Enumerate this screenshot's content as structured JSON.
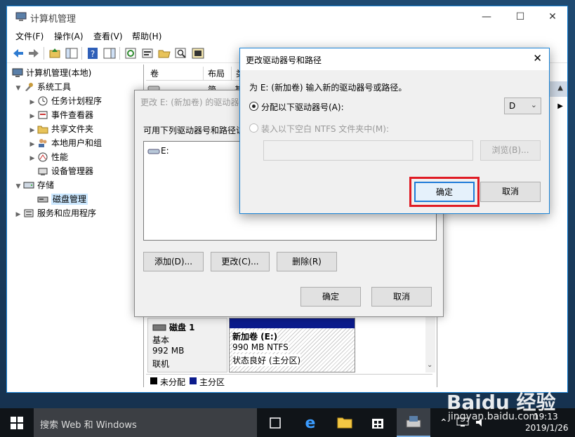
{
  "main_window": {
    "title": "计算机管理",
    "menus": [
      "文件(F)",
      "操作(A)",
      "查看(V)",
      "帮助(H)"
    ]
  },
  "tree": {
    "root": "计算机管理(本地)",
    "system_tools": "系统工具",
    "task_scheduler": "任务计划程序",
    "event_viewer": "事件查看器",
    "shared_folders": "共享文件夹",
    "local_users": "本地用户和组",
    "performance": "性能",
    "device_manager": "设备管理器",
    "storage": "存储",
    "disk_management": "磁盘管理",
    "services_apps": "服务和应用程序"
  },
  "volume_list": {
    "col_volume": "卷",
    "col_layout": "布局",
    "col_type_partial": "类",
    "row_layout": "简单",
    "row_type_partial": "基"
  },
  "disk": {
    "name": "磁盘 1",
    "type": "基本",
    "size": "992 MB",
    "status": "联机",
    "volume_name": "新加卷  (E:)",
    "volume_size": "990 MB NTFS",
    "volume_status": "状态良好 (主分区)"
  },
  "legend": {
    "unallocated": "未分配",
    "primary": "主分区"
  },
  "bg_dialog": {
    "title": "更改 E: (新加卷) 的驱动器号和路径",
    "description": "可用下列驱动器号和路径访",
    "drive_item": "E:",
    "add_button": "添加(D)...",
    "change_button": "更改(C)...",
    "remove_button": "删除(R)",
    "ok_button": "确定",
    "cancel_button": "取消"
  },
  "dialog": {
    "title": "更改驱动器号和路径",
    "instruction": "为 E: (新加卷) 输入新的驱动器号或路径。",
    "assign_option": "分配以下驱动器号(A):",
    "drive_letter": "D",
    "mount_option": "装入以下空白 NTFS 文件夹中(M):",
    "path_value": "",
    "browse_button": "浏览(B)...",
    "ok_button": "确定",
    "cancel_button": "取消",
    "highlight_color": "#e01b24"
  },
  "taskbar": {
    "search_placeholder": "搜索 Web 和 Windows",
    "time": "19:13",
    "date": "2019/1/26"
  },
  "watermark": {
    "brand": "Baidu 经验",
    "url": "jingyan.baidu.com"
  }
}
